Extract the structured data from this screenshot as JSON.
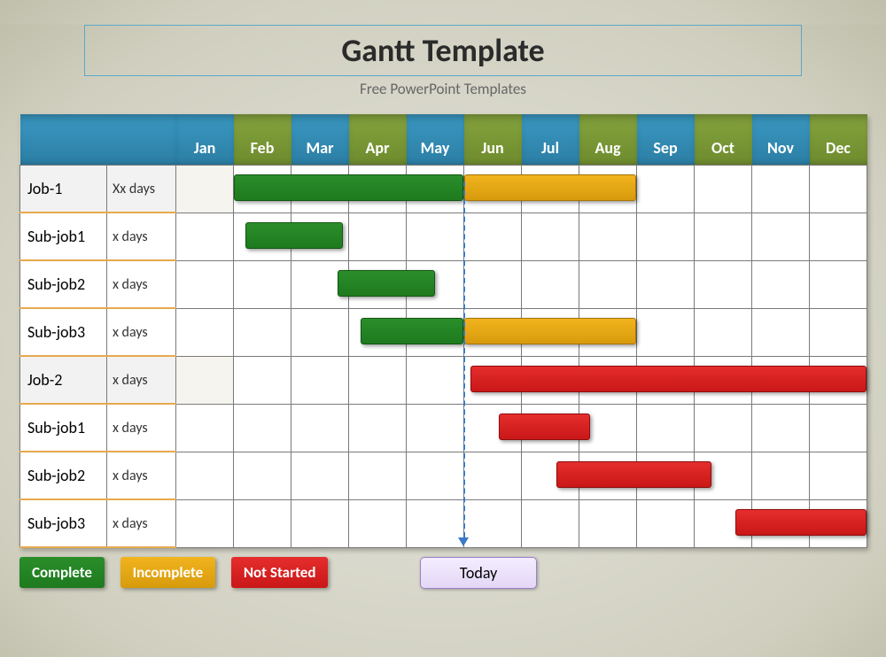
{
  "title": "Gantt Template",
  "subtitle": "Free PowerPoint Templates",
  "months": [
    "Jan",
    "Feb",
    "Mar",
    "Apr",
    "May",
    "Jun",
    "Jul",
    "Aug",
    "Sep",
    "Oct",
    "Nov",
    "Dec"
  ],
  "legend": {
    "complete": "Complete",
    "incomplete": "Incomplete",
    "notstarted": "Not Started"
  },
  "today_label": "Today",
  "rows": [
    {
      "label": "Job-1",
      "dur": "Xx days"
    },
    {
      "label": "Sub-job1",
      "dur": "x days"
    },
    {
      "label": "Sub-job2",
      "dur": "x days"
    },
    {
      "label": "Sub-job3",
      "dur": "x days"
    },
    {
      "label": "Job-2",
      "dur": "x days"
    },
    {
      "label": "Sub-job1",
      "dur": "x days"
    },
    {
      "label": "Sub-job2",
      "dur": "x days"
    },
    {
      "label": "Sub-job3",
      "dur": "x days"
    }
  ],
  "chart_data": {
    "type": "gantt",
    "categories": [
      "Jan",
      "Feb",
      "Mar",
      "Apr",
      "May",
      "Jun",
      "Jul",
      "Aug",
      "Sep",
      "Oct",
      "Nov",
      "Dec"
    ],
    "today_index": 5.0,
    "status_colors": {
      "complete": "#1e7a1e",
      "incomplete": "#d79a0c",
      "notstarted": "#c91717"
    },
    "tasks": [
      {
        "name": "Job-1",
        "duration_label": "Xx days",
        "level": 0,
        "segments": [
          {
            "start": 1.0,
            "end": 5.0,
            "status": "complete"
          },
          {
            "start": 5.0,
            "end": 8.0,
            "status": "incomplete"
          }
        ]
      },
      {
        "name": "Sub-job1",
        "duration_label": "x days",
        "level": 1,
        "segments": [
          {
            "start": 1.2,
            "end": 2.9,
            "status": "complete"
          }
        ]
      },
      {
        "name": "Sub-job2",
        "duration_label": "x days",
        "level": 1,
        "segments": [
          {
            "start": 2.8,
            "end": 4.5,
            "status": "complete"
          }
        ]
      },
      {
        "name": "Sub-job3",
        "duration_label": "x days",
        "level": 1,
        "segments": [
          {
            "start": 3.2,
            "end": 5.0,
            "status": "complete"
          },
          {
            "start": 5.0,
            "end": 8.0,
            "status": "incomplete"
          }
        ]
      },
      {
        "name": "Job-2",
        "duration_label": "x days",
        "level": 0,
        "segments": [
          {
            "start": 5.1,
            "end": 12.0,
            "status": "notstarted"
          }
        ]
      },
      {
        "name": "Sub-job1",
        "duration_label": "x days",
        "level": 1,
        "segments": [
          {
            "start": 5.6,
            "end": 7.2,
            "status": "notstarted"
          }
        ]
      },
      {
        "name": "Sub-job2",
        "duration_label": "x days",
        "level": 1,
        "segments": [
          {
            "start": 6.6,
            "end": 9.3,
            "status": "notstarted"
          }
        ]
      },
      {
        "name": "Sub-job3",
        "duration_label": "x days",
        "level": 1,
        "segments": [
          {
            "start": 9.7,
            "end": 12.0,
            "status": "notstarted"
          }
        ]
      }
    ]
  }
}
